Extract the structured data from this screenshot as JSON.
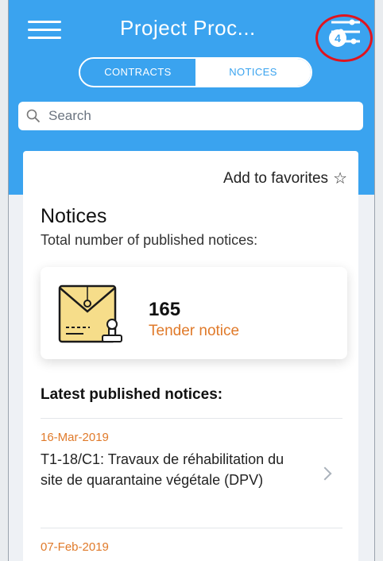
{
  "header": {
    "title": "Project Proc...",
    "filter_badge": "4"
  },
  "tabs": [
    {
      "label": "CONTRACTS",
      "active": false
    },
    {
      "label": "NOTICES",
      "active": true
    }
  ],
  "search": {
    "placeholder": "Search"
  },
  "card": {
    "favorites_label": "Add to favorites",
    "favorites_icon": "star-outline-icon",
    "section_title": "Notices",
    "total_label": "Total number of published notices:",
    "stat": {
      "count": "165",
      "label": "Tender notice",
      "icon": "envelope-stamp-icon"
    },
    "latest_title": "Latest published notices:",
    "notices": [
      {
        "date": "16-Mar-2019",
        "text": "T1-18/C1: Travaux de réhabilitation du site de quarantaine végétale (DPV)"
      },
      {
        "date": "07-Feb-2019",
        "text": ""
      }
    ]
  },
  "colors": {
    "header_blue": "#3aa3ef",
    "accent_orange": "#e07a2a",
    "highlight_ring": "#e0141e"
  }
}
